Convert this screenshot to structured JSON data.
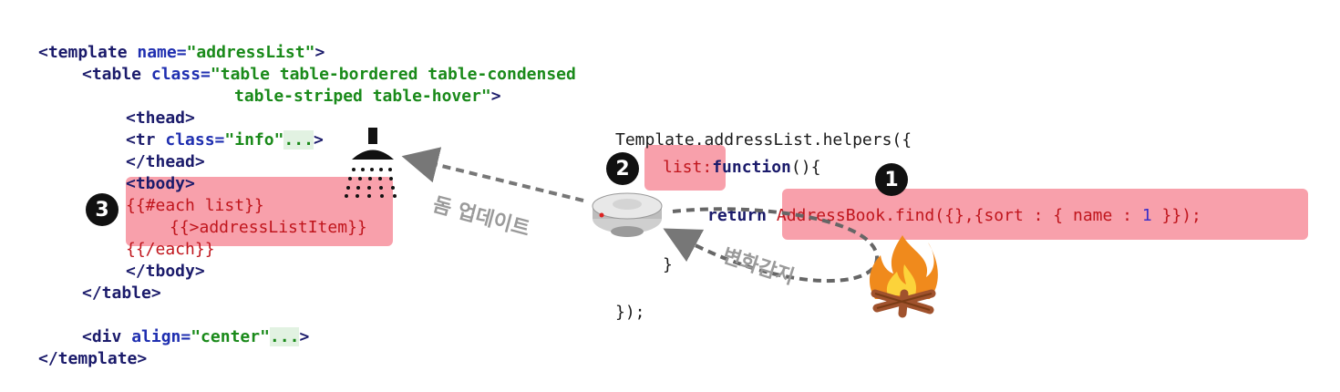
{
  "template_code": {
    "line1": {
      "open": "<template ",
      "attr": "name=",
      "val": "\"addressList\"",
      "close": ">"
    },
    "line2": {
      "open": "<table ",
      "attr": "class=",
      "val": "\"table table-bordered table-condensed"
    },
    "line3": {
      "val": "table-striped table-hover\"",
      "close": ">"
    },
    "line4": "<thead>",
    "line5": {
      "open": "<tr ",
      "attr": "class=",
      "val": "\"info\"",
      "fold": "...",
      "close": ">"
    },
    "line6": "</thead>",
    "line7": "<tbody>",
    "line8": "{{#each list}}",
    "line9": "{{>addressListItem}}",
    "line10": "{{/each}}",
    "line11": "</tbody>",
    "line12": "</table>",
    "line13": {
      "open": "<div ",
      "attr": "align=",
      "val": "\"center\"",
      "fold": "...",
      "close": ">"
    },
    "line14": "</template>"
  },
  "helpers_code": {
    "line1": "Template.addressList.helpers({",
    "line2_key": "list:",
    "line2_fn": "function",
    "line2_rest": "(){",
    "line3_kw": "return",
    "line3_a": "AddressBook.find({},{sort : { name : ",
    "line3_num": "1",
    "line3_b": " }});",
    "line4": "}",
    "line5": "});"
  },
  "badges": {
    "one": "1",
    "two": "2",
    "three": "3"
  },
  "labels": {
    "dom_update": "돔 업데이트",
    "change_detect": "변화감지"
  },
  "icons": [
    "shower-icon",
    "smoke-detector-icon",
    "campfire-icon"
  ],
  "colors": {
    "highlight": "#f5808f",
    "arrow": "#777777",
    "badge": "#111111"
  }
}
